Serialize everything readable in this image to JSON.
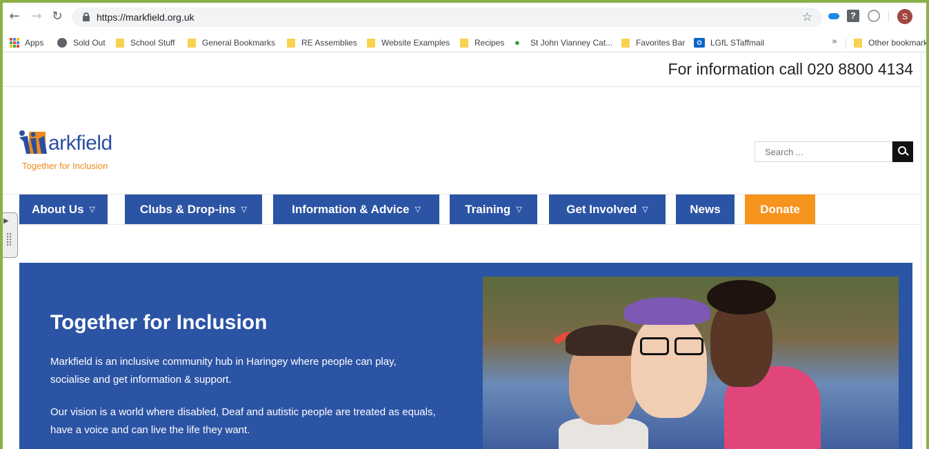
{
  "browser": {
    "url": "https://markfield.org.uk",
    "avatar_letter": "S"
  },
  "bookmarks": {
    "apps": "Apps",
    "items": [
      "Sold Out",
      "School Stuff",
      "General Bookmarks",
      "RE Assemblies",
      "Website Examples",
      "Recipes",
      "St John Vianney Cat...",
      "Favorites Bar",
      "LGfL STaffmail"
    ],
    "more": "»",
    "other": "Other bookmarks"
  },
  "site": {
    "info_call": "For information call 020 8800 4134",
    "logo_word": "arkfield",
    "logo_tagline": "Together for Inclusion",
    "search_placeholder": "Search ...",
    "menu": [
      "About Us",
      "Clubs & Drop-ins",
      "Information & Advice",
      "Training",
      "Get Involved",
      "News",
      "Donate"
    ],
    "hero": {
      "title": "Together for Inclusion",
      "p1": "Markfield is an inclusive community hub in Haringey where people can play, socialise and get information & support.",
      "p2": "Our vision is a world where disabled, Deaf and autistic people are treated as equals, have a voice and can live the life they want."
    }
  },
  "colors": {
    "brand_blue": "#2c54a5",
    "donate_orange": "#f7941d",
    "window_green": "#8bb04a"
  }
}
